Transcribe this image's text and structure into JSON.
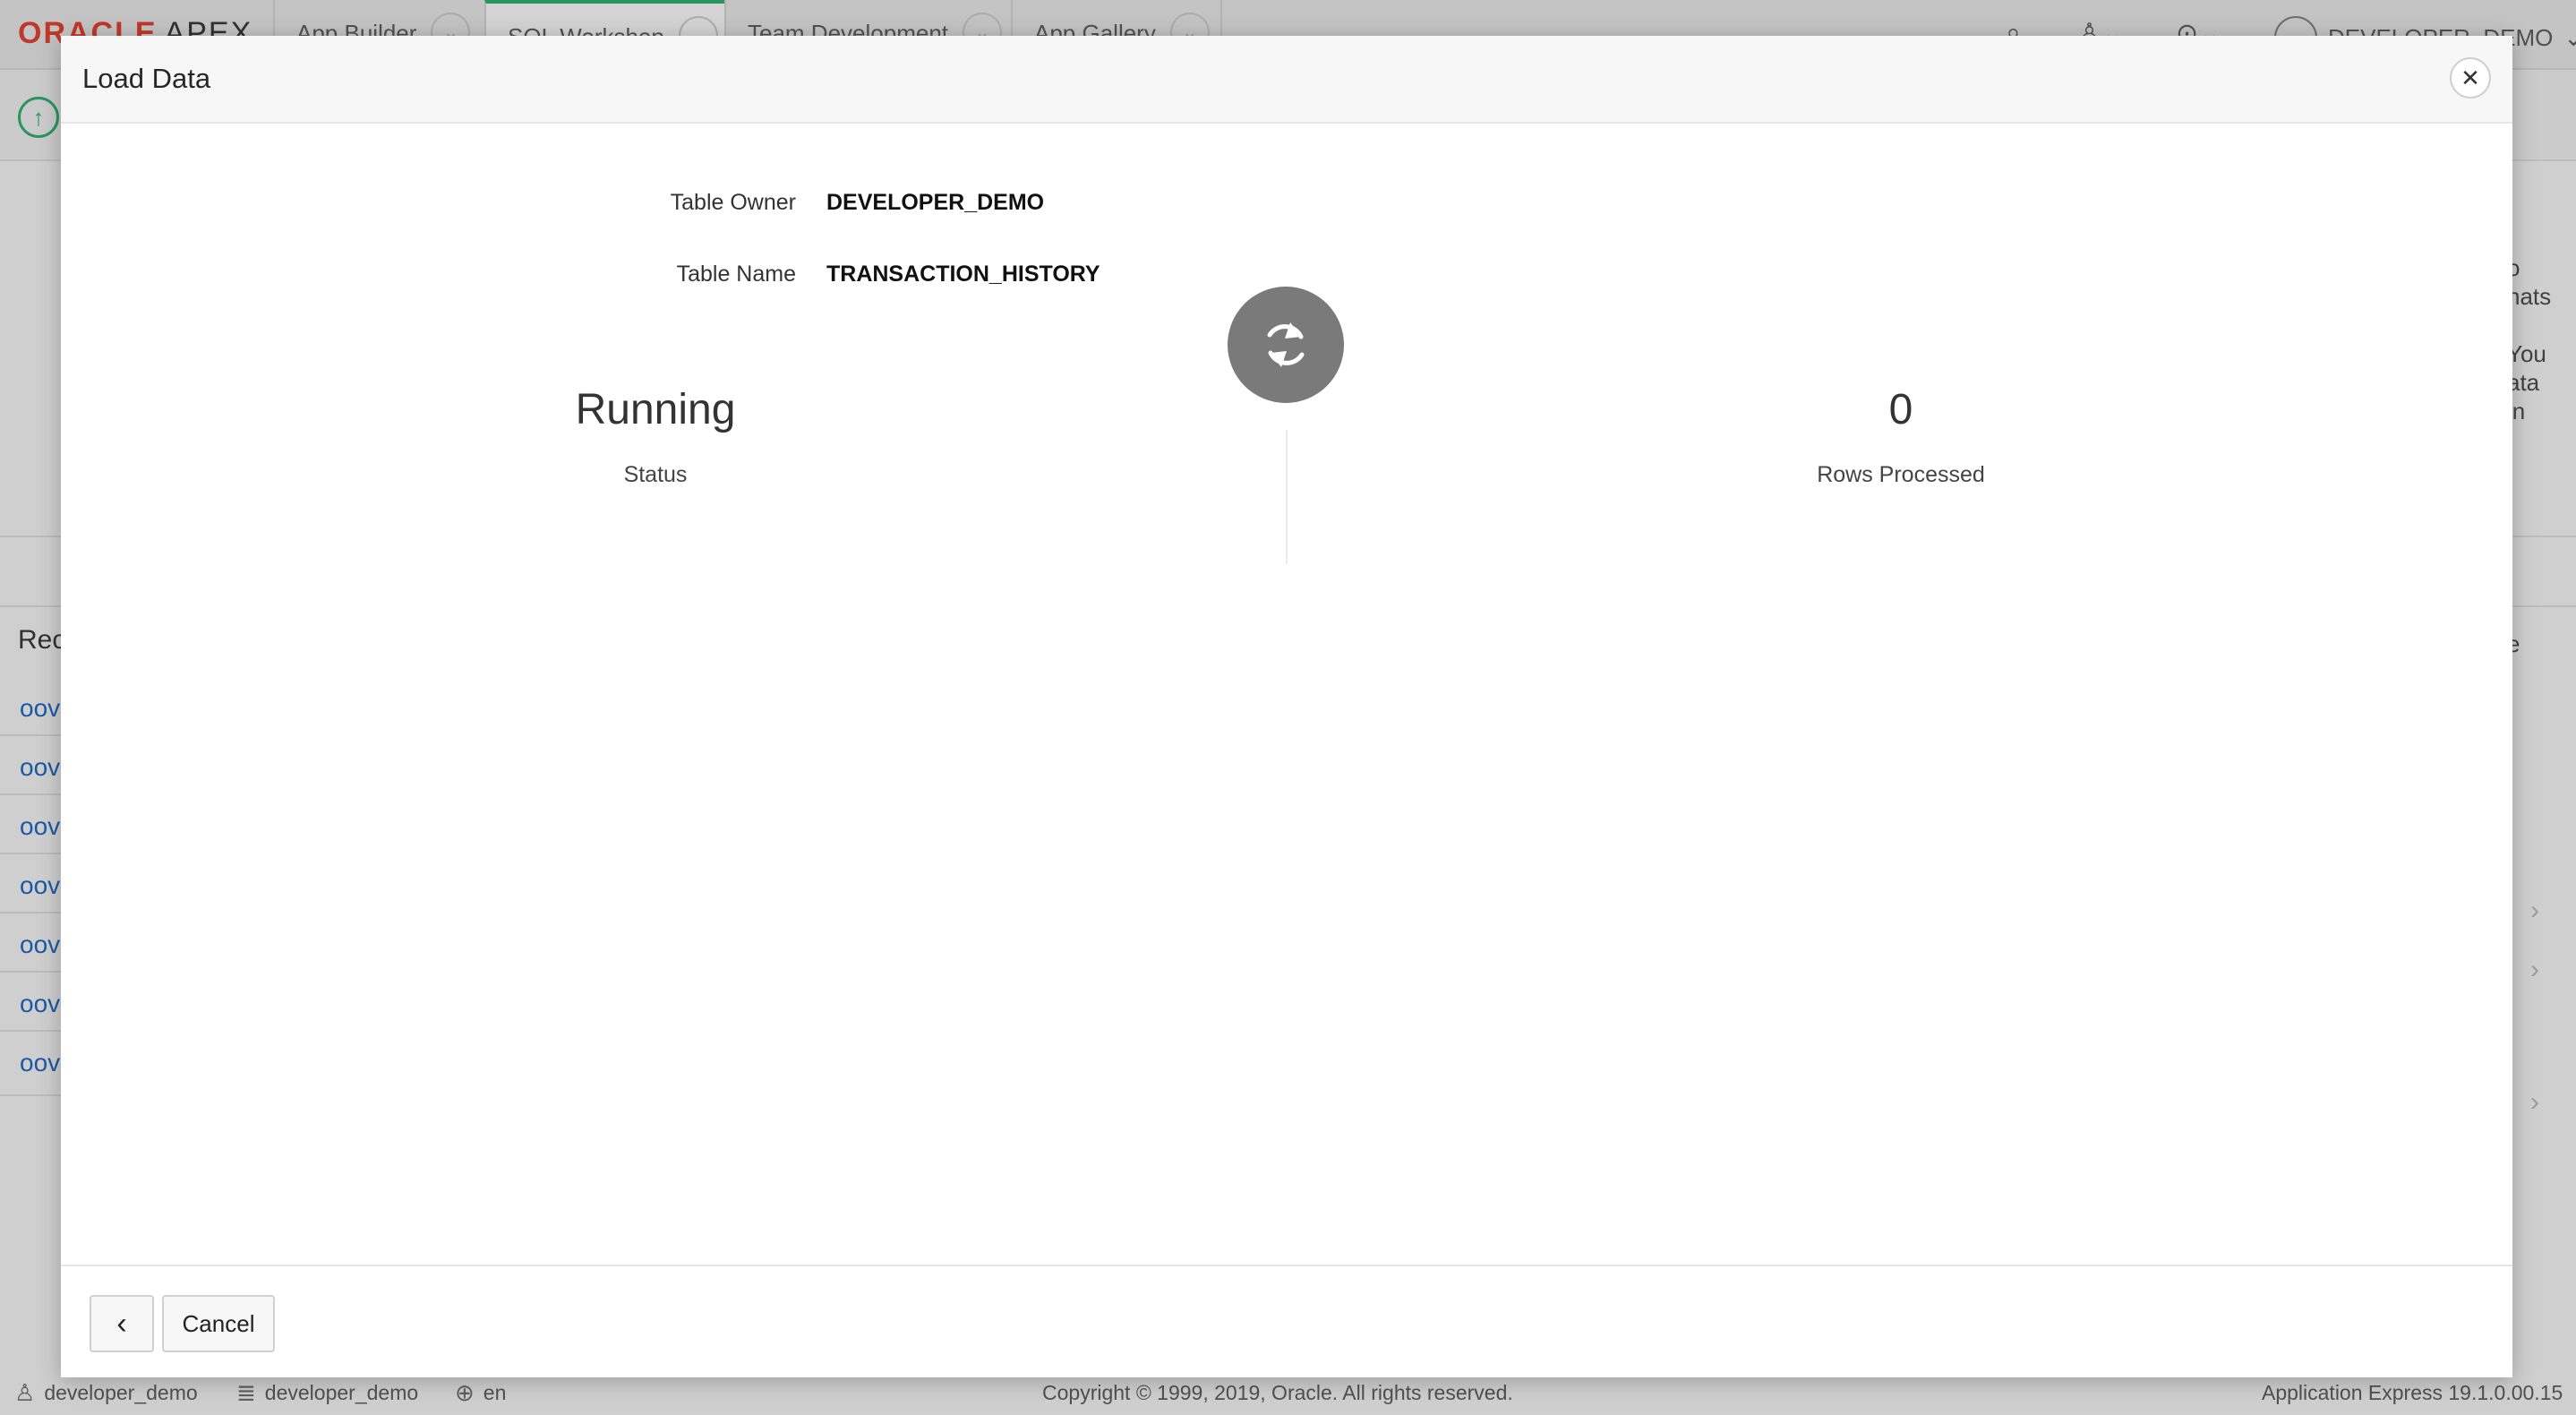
{
  "app": {
    "logo_oracle": "ORACLE",
    "logo_apex": "APEX",
    "tabs": [
      {
        "label": "App Builder"
      },
      {
        "label": "SQL Workshop"
      },
      {
        "label": "Team Development"
      },
      {
        "label": "App Gallery"
      }
    ],
    "user_name": "DEVELOPER_DEMO",
    "right_text": [
      "o",
      "nats",
      "You",
      "ata",
      "in",
      "e"
    ],
    "left_heading": "Rec",
    "links": [
      "oov",
      "oov",
      "oov",
      "oov",
      "oov",
      "oov",
      "oov"
    ]
  },
  "footer": {
    "user": "developer_demo",
    "workspace": "developer_demo",
    "language": "en",
    "copyright": "Copyright © 1999, 2019, Oracle. All rights reserved.",
    "version": "Application Express 19.1.0.00.15"
  },
  "modal": {
    "title": "Load Data",
    "close_label": "✕",
    "table_owner_label": "Table Owner",
    "table_owner_value": "DEVELOPER_DEMO",
    "table_name_label": "Table Name",
    "table_name_value": "TRANSACTION_HISTORY",
    "status_value": "Running",
    "status_label": "Status",
    "rows_value": "0",
    "rows_label": "Rows Processed",
    "back_label": "‹",
    "cancel_label": "Cancel"
  },
  "icons": {
    "spinner": "refresh-icon",
    "close": "close-icon",
    "back": "chevron-left-icon"
  },
  "colors": {
    "accent_green": "#2aa366",
    "oracle_red": "#d23a2a",
    "link_blue": "#1a5fb4",
    "spinner_gray": "#7a7a7a"
  }
}
